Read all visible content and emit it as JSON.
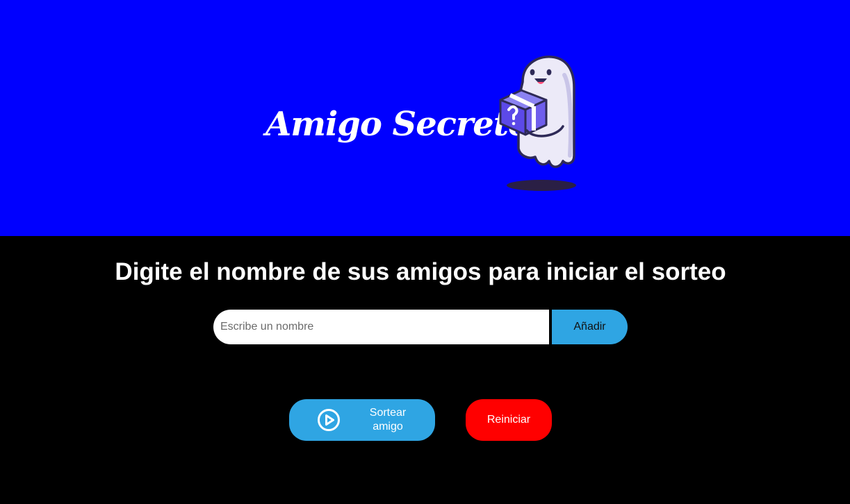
{
  "header": {
    "title": "Amigo Secreto",
    "mascot_icon": "ghost-with-gift-box-icon",
    "background_color": "#0000FF"
  },
  "main": {
    "heading": "Digite el nombre de sus amigos para iniciar el sorteo",
    "name_input": {
      "placeholder": "Escribe un nombre",
      "value": ""
    },
    "add_button_label": "Añadir",
    "draw_button": {
      "label": "Sortear amigo",
      "icon": "play-circle-icon"
    },
    "reset_button_label": "Reiniciar",
    "colors": {
      "primary_button": "#2FA5E3",
      "reset_button": "#FF0000",
      "background": "#000000"
    }
  }
}
